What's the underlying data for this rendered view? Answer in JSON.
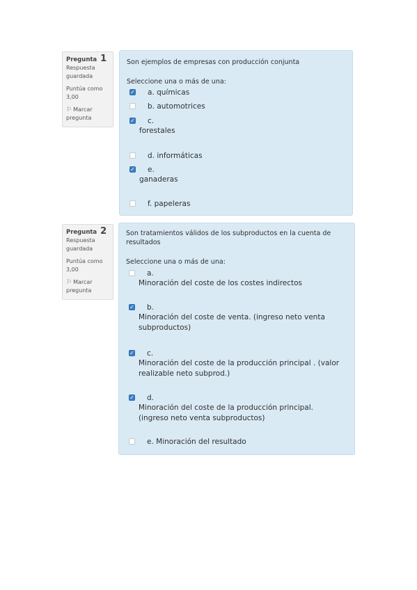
{
  "q1": {
    "info": {
      "label": "Pregunta",
      "number": "1",
      "status_1": "Respuesta",
      "status_2": "guardada",
      "score_1": "Puntúa como",
      "score_2": "3,00",
      "flag_1": "Marcar",
      "flag_2": "pregunta"
    },
    "text": "Son ejemplos de empresas con producción conjunta",
    "prompt": "Seleccione una o más de una:",
    "options": [
      {
        "letter": "a. químicas",
        "label": "",
        "checked": true
      },
      {
        "letter": "b. automotrices",
        "label": "",
        "checked": false
      },
      {
        "letter": "c.",
        "label": "forestales",
        "checked": true
      },
      {
        "letter": "d. informáticas",
        "label": "",
        "checked": false
      },
      {
        "letter": "e.",
        "label": "ganaderas",
        "checked": true
      },
      {
        "letter": "f. papeleras",
        "label": "",
        "checked": false
      }
    ]
  },
  "q2": {
    "info": {
      "label": "Pregunta",
      "number": "2",
      "status_1": "Respuesta",
      "status_2": "guardada",
      "score_1": "Puntúa como",
      "score_2": "3,00",
      "flag_1": "Marcar",
      "flag_2": "pregunta"
    },
    "text_1": "Son tratamientos válidos de los subproductos en la cuenta de",
    "text_2": "resultados",
    "prompt": "Seleccione una o más de una:",
    "options": [
      {
        "letter": "a.",
        "line1": "Minoración del coste de los costes indirectos",
        "line2": "",
        "checked": false
      },
      {
        "letter": "b.",
        "line1": "Minoración del coste de venta. (ingreso neto venta",
        "line2": "subproductos)",
        "checked": true
      },
      {
        "letter": "c.",
        "line1": "Minoración del coste de la producción principal . (valor",
        "line2": "realizable neto subprod.)",
        "checked": true
      },
      {
        "letter": "d.",
        "line1": "Minoración del coste de la producción principal.",
        "line2": "(ingreso neto venta subproductos)",
        "checked": true
      },
      {
        "letter": "e. Minoración del resultado",
        "line1": "",
        "line2": "",
        "checked": false
      }
    ]
  },
  "icons": {
    "checked": "checkbox-checked-icon",
    "unchecked": "checkbox-empty-icon",
    "flag": "flag-icon"
  }
}
